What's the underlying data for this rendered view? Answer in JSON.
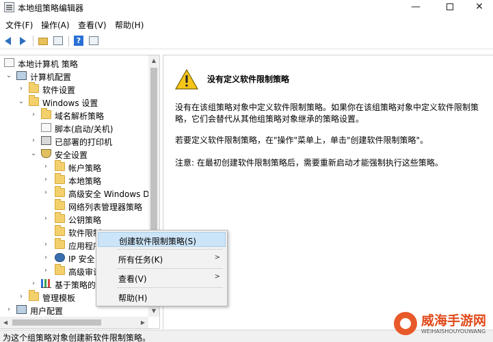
{
  "window": {
    "title": "本地组策略编辑器",
    "min_glyph": "—",
    "close_glyph": "✕"
  },
  "menu": [
    "文件(F)",
    "操作(A)",
    "查看(V)",
    "帮助(H)"
  ],
  "tree": {
    "items": [
      {
        "label": "本地计算机 策略"
      },
      {
        "label": "计算机配置"
      },
      {
        "label": "软件设置"
      },
      {
        "label": "Windows 设置"
      },
      {
        "label": "域名解析策略"
      },
      {
        "label": "脚本(启动/关机)"
      },
      {
        "label": "已部署的打印机"
      },
      {
        "label": "安全设置"
      },
      {
        "label": "帐户策略"
      },
      {
        "label": "本地策略"
      },
      {
        "label": "高级安全 Windows D"
      },
      {
        "label": "网络列表管理器策略"
      },
      {
        "label": "公钥策略"
      },
      {
        "label": "软件限制"
      },
      {
        "label": "应用程序"
      },
      {
        "label": "IP 安全"
      },
      {
        "label": "高级审计"
      },
      {
        "label": "基于策略的"
      },
      {
        "label": "管理模板"
      },
      {
        "label": "用户配置"
      }
    ]
  },
  "content": {
    "title": "没有定义软件限制策略",
    "para1": "没有在该组策略对象中定义软件限制策略。如果你在该组策略对象中定义软件限制策略，它们会替代从其他组策略对象继承的策略设置。",
    "para2": "若要定义软件限制策略，在\"操作\"菜单上，单击\"创建软件限制策略\"。",
    "para3": "注意: 在最初创建软件限制策略后，需要重新启动才能强制执行这些策略。"
  },
  "context_menu": {
    "items": [
      {
        "label": "创建软件限制策略(S)"
      },
      {
        "label": "所有任务(K)",
        "arrow": ">"
      },
      {
        "label": "查看(V)",
        "arrow": ">"
      },
      {
        "label": "帮助(H)"
      }
    ]
  },
  "status": {
    "text": "为这个组策略对象创建新软件限制策略。"
  },
  "watermark": {
    "title": "威海手游网",
    "subtitle": "WEIHAISHOUYOUWANG"
  },
  "colors": {
    "highlight": "#cce4f7",
    "warning": "#f5c518",
    "nav_arrow": "#2f6fbf"
  }
}
